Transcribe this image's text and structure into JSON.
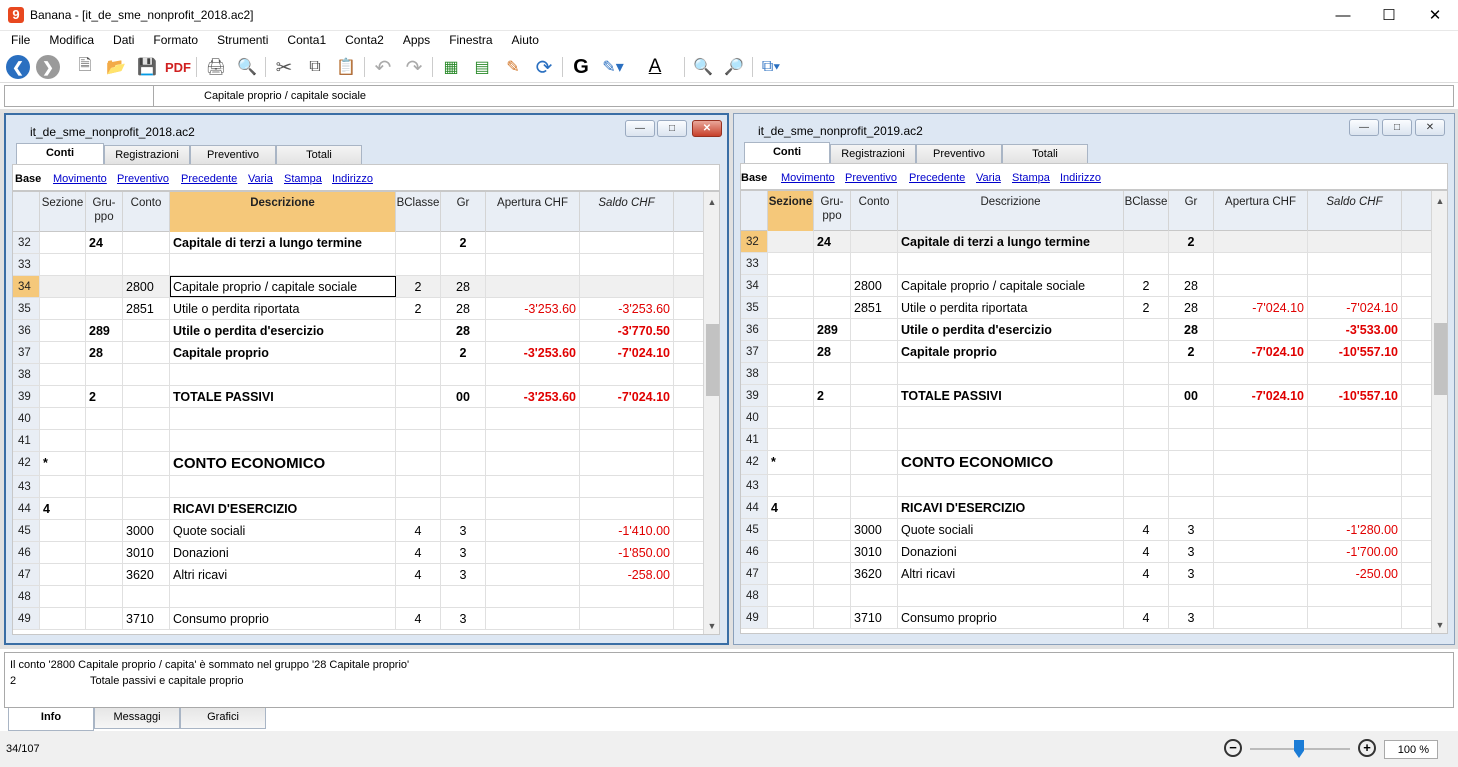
{
  "app": {
    "logo": "9",
    "title": "Banana - [it_de_sme_nonprofit_2018.ac2]"
  },
  "menu": [
    "File",
    "Modifica",
    "Dati",
    "Formato",
    "Strumenti",
    "Conta1",
    "Conta2",
    "Apps",
    "Finestra",
    "Aiuto"
  ],
  "cellbar": {
    "ref": "",
    "value": "Capitale proprio / capitale sociale"
  },
  "tabs": [
    "Conti",
    "Registrazioni",
    "Preventivo",
    "Totali"
  ],
  "views": [
    "Base",
    "Movimento",
    "Preventivo",
    "Precedente",
    "Varia",
    "Stampa",
    "Indirizzo"
  ],
  "headers": {
    "sezione": "Sezione",
    "gruppo1": "Gru-",
    "gruppo2": "ppo",
    "conto": "Conto",
    "descrizione": "Descrizione",
    "bclasse": "BClasse",
    "gr": "Gr",
    "apertura": "Apertura CHF",
    "saldo": "Saldo CHF"
  },
  "left": {
    "title": "it_de_sme_nonprofit_2018.ac2",
    "rows": [
      {
        "n": "32",
        "sez": "",
        "grp": "24",
        "conto": "",
        "desc": "Capitale di terzi a lungo termine",
        "bcl": "",
        "gr": "2",
        "ap": "",
        "sal": "",
        "bold": true
      },
      {
        "n": "33",
        "sez": "",
        "grp": "",
        "conto": "",
        "desc": "",
        "bcl": "",
        "gr": "",
        "ap": "",
        "sal": ""
      },
      {
        "n": "34",
        "sez": "",
        "grp": "",
        "conto": "2800",
        "desc": "Capitale proprio / capitale sociale",
        "bcl": "2",
        "gr": "28",
        "ap": "",
        "sal": ""
      },
      {
        "n": "35",
        "sez": "",
        "grp": "",
        "conto": "2851",
        "desc": "Utile o perdita riportata",
        "bcl": "2",
        "gr": "28",
        "ap": "-3'253.60",
        "sal": "-3'253.60"
      },
      {
        "n": "36",
        "sez": "",
        "grp": "289",
        "conto": "",
        "desc": "Utile o perdita d'esercizio",
        "bcl": "",
        "gr": "28",
        "ap": "",
        "sal": "-3'770.50",
        "bold": true
      },
      {
        "n": "37",
        "sez": "",
        "grp": "28",
        "conto": "",
        "desc": "Capitale proprio",
        "bcl": "",
        "gr": "2",
        "ap": "-3'253.60",
        "sal": "-7'024.10",
        "bold": true
      },
      {
        "n": "38",
        "sez": "",
        "grp": "",
        "conto": "",
        "desc": "",
        "bcl": "",
        "gr": "",
        "ap": "",
        "sal": ""
      },
      {
        "n": "39",
        "sez": "",
        "grp": "2",
        "conto": "",
        "desc": "TOTALE PASSIVI",
        "bcl": "",
        "gr": "00",
        "ap": "-3'253.60",
        "sal": "-7'024.10",
        "bold": true
      },
      {
        "n": "40",
        "sez": "",
        "grp": "",
        "conto": "",
        "desc": "",
        "bcl": "",
        "gr": "",
        "ap": "",
        "sal": ""
      },
      {
        "n": "41",
        "sez": "",
        "grp": "",
        "conto": "",
        "desc": "",
        "bcl": "",
        "gr": "",
        "ap": "",
        "sal": ""
      },
      {
        "n": "42",
        "sez": "*",
        "grp": "",
        "conto": "",
        "desc": "CONTO ECONOMICO",
        "bcl": "",
        "gr": "",
        "ap": "",
        "sal": "",
        "big": true,
        "bold": true
      },
      {
        "n": "43",
        "sez": "",
        "grp": "",
        "conto": "",
        "desc": "",
        "bcl": "",
        "gr": "",
        "ap": "",
        "sal": ""
      },
      {
        "n": "44",
        "sez": "4",
        "grp": "",
        "conto": "",
        "desc": "RICAVI D'ESERCIZIO",
        "bcl": "",
        "gr": "",
        "ap": "",
        "sal": "",
        "bold": true
      },
      {
        "n": "45",
        "sez": "",
        "grp": "",
        "conto": "3000",
        "desc": "Quote sociali",
        "bcl": "4",
        "gr": "3",
        "ap": "",
        "sal": "-1'410.00"
      },
      {
        "n": "46",
        "sez": "",
        "grp": "",
        "conto": "3010",
        "desc": "Donazioni",
        "bcl": "4",
        "gr": "3",
        "ap": "",
        "sal": "-1'850.00"
      },
      {
        "n": "47",
        "sez": "",
        "grp": "",
        "conto": "3620",
        "desc": "Altri ricavi",
        "bcl": "4",
        "gr": "3",
        "ap": "",
        "sal": "-258.00"
      },
      {
        "n": "48",
        "sez": "",
        "grp": "",
        "conto": "",
        "desc": "",
        "bcl": "",
        "gr": "",
        "ap": "",
        "sal": ""
      },
      {
        "n": "49",
        "sez": "",
        "grp": "",
        "conto": "3710",
        "desc": "Consumo proprio",
        "bcl": "4",
        "gr": "3",
        "ap": "",
        "sal": ""
      }
    ]
  },
  "right": {
    "title": "it_de_sme_nonprofit_2019.ac2",
    "rows": [
      {
        "n": "32",
        "sez": "",
        "grp": "24",
        "conto": "",
        "desc": "Capitale di terzi a lungo termine",
        "bcl": "",
        "gr": "2",
        "ap": "",
        "sal": "",
        "bold": true
      },
      {
        "n": "33",
        "sez": "",
        "grp": "",
        "conto": "",
        "desc": "",
        "bcl": "",
        "gr": "",
        "ap": "",
        "sal": ""
      },
      {
        "n": "34",
        "sez": "",
        "grp": "",
        "conto": "2800",
        "desc": "Capitale proprio / capitale sociale",
        "bcl": "2",
        "gr": "28",
        "ap": "",
        "sal": ""
      },
      {
        "n": "35",
        "sez": "",
        "grp": "",
        "conto": "2851",
        "desc": "Utile o perdita riportata",
        "bcl": "2",
        "gr": "28",
        "ap": "-7'024.10",
        "sal": "-7'024.10"
      },
      {
        "n": "36",
        "sez": "",
        "grp": "289",
        "conto": "",
        "desc": "Utile o perdita d'esercizio",
        "bcl": "",
        "gr": "28",
        "ap": "",
        "sal": "-3'533.00",
        "bold": true
      },
      {
        "n": "37",
        "sez": "",
        "grp": "28",
        "conto": "",
        "desc": "Capitale proprio",
        "bcl": "",
        "gr": "2",
        "ap": "-7'024.10",
        "sal": "-10'557.10",
        "bold": true
      },
      {
        "n": "38",
        "sez": "",
        "grp": "",
        "conto": "",
        "desc": "",
        "bcl": "",
        "gr": "",
        "ap": "",
        "sal": ""
      },
      {
        "n": "39",
        "sez": "",
        "grp": "2",
        "conto": "",
        "desc": "TOTALE PASSIVI",
        "bcl": "",
        "gr": "00",
        "ap": "-7'024.10",
        "sal": "-10'557.10",
        "bold": true
      },
      {
        "n": "40",
        "sez": "",
        "grp": "",
        "conto": "",
        "desc": "",
        "bcl": "",
        "gr": "",
        "ap": "",
        "sal": ""
      },
      {
        "n": "41",
        "sez": "",
        "grp": "",
        "conto": "",
        "desc": "",
        "bcl": "",
        "gr": "",
        "ap": "",
        "sal": ""
      },
      {
        "n": "42",
        "sez": "*",
        "grp": "",
        "conto": "",
        "desc": "CONTO ECONOMICO",
        "bcl": "",
        "gr": "",
        "ap": "",
        "sal": "",
        "big": true,
        "bold": true
      },
      {
        "n": "43",
        "sez": "",
        "grp": "",
        "conto": "",
        "desc": "",
        "bcl": "",
        "gr": "",
        "ap": "",
        "sal": ""
      },
      {
        "n": "44",
        "sez": "4",
        "grp": "",
        "conto": "",
        "desc": "RICAVI D'ESERCIZIO",
        "bcl": "",
        "gr": "",
        "ap": "",
        "sal": "",
        "bold": true
      },
      {
        "n": "45",
        "sez": "",
        "grp": "",
        "conto": "3000",
        "desc": "Quote sociali",
        "bcl": "4",
        "gr": "3",
        "ap": "",
        "sal": "-1'280.00"
      },
      {
        "n": "46",
        "sez": "",
        "grp": "",
        "conto": "3010",
        "desc": "Donazioni",
        "bcl": "4",
        "gr": "3",
        "ap": "",
        "sal": "-1'700.00"
      },
      {
        "n": "47",
        "sez": "",
        "grp": "",
        "conto": "3620",
        "desc": "Altri ricavi",
        "bcl": "4",
        "gr": "3",
        "ap": "",
        "sal": "-250.00"
      },
      {
        "n": "48",
        "sez": "",
        "grp": "",
        "conto": "",
        "desc": "",
        "bcl": "",
        "gr": "",
        "ap": "",
        "sal": ""
      },
      {
        "n": "49",
        "sez": "",
        "grp": "",
        "conto": "3710",
        "desc": "Consumo proprio",
        "bcl": "4",
        "gr": "3",
        "ap": "",
        "sal": ""
      }
    ]
  },
  "info": {
    "line1": "Il conto '2800 Capitale proprio / capita' è sommato nel gruppo '28 Capitale proprio'",
    "line2_a": "2",
    "line2_b": "Totale passivi e capitale proprio"
  },
  "bottom_tabs": [
    "Info",
    "Messaggi",
    "Grafici"
  ],
  "status": {
    "position": "34/107",
    "zoom": "100 %",
    "zoom_level_fraction": 0.5
  },
  "colors": {
    "accent": "#1b7cd6",
    "negative": "#e00000",
    "selected_header": "#f5c87a"
  }
}
